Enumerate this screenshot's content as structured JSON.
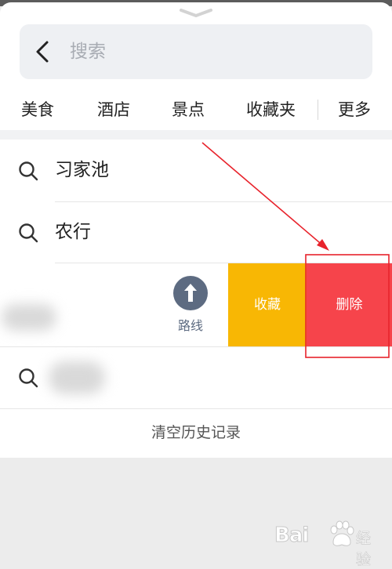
{
  "search": {
    "placeholder": "搜索"
  },
  "tabs": [
    {
      "label": "美食"
    },
    {
      "label": "酒店"
    },
    {
      "label": "景点"
    },
    {
      "label": "收藏夹"
    },
    {
      "label": "更多"
    }
  ],
  "history": [
    {
      "label": "习家池"
    },
    {
      "label": "农行"
    }
  ],
  "swipe_row": {
    "route_label": "路线",
    "favorite_label": "收藏",
    "delete_label": "删除"
  },
  "clear_history_label": "清空历史记录",
  "colors": {
    "favorite": "#f8b704",
    "delete": "#f6444b",
    "route_icon": "#5d6b81",
    "annotation": "#e8232c"
  },
  "watermark": {
    "text": "Bai",
    "suffix": "经验"
  }
}
